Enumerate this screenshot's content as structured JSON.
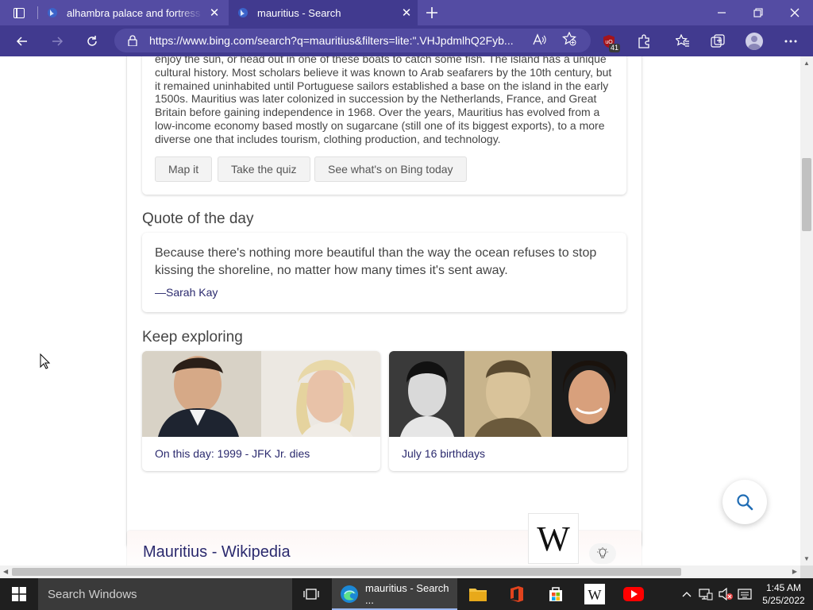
{
  "browser": {
    "tabs": [
      {
        "title": "alhambra palace and fortress sp",
        "active": false
      },
      {
        "title": "mauritius - Search",
        "active": true
      }
    ],
    "url": "https://www.bing.com/search?q=mauritius&filters=lite:\".VHJpdmlhQ2Fyb...",
    "extension_badge": "41",
    "accent_color": "#544ca3"
  },
  "page": {
    "description": "enjoy the sun, or head out in one of these boats to catch some fish. The island has a unique cultural history. Most scholars believe it was known to Arab seafarers by the 10th century, but it remained uninhabited until Portuguese sailors established a base on the island in the early 1500s. Mauritius was later colonized in succession by the Netherlands, France, and Great Britain before gaining independence in 1968. Over the years, Mauritius has evolved from a low-income economy based mostly on sugarcane (still one of its biggest exports), to a more diverse one that includes tourism, clothing production, and technology.",
    "buttons": [
      "Map it",
      "Take the quiz",
      "See what's on Bing today"
    ],
    "quote_heading": "Quote of the day",
    "quote_text": "Because there's nothing more beautiful than the way the ocean refuses to stop kissing the shoreline, no matter how many times it's sent away.",
    "quote_author": "—Sarah Kay",
    "explore_heading": "Keep exploring",
    "explore_items": [
      {
        "label": "On this day: 1999 - JFK Jr. dies"
      },
      {
        "label": "July 16 birthdays"
      }
    ],
    "wiki_title": "Mauritius - Wikipedia",
    "wiki_logo": "W"
  },
  "taskbar": {
    "search_placeholder": "Search Windows",
    "active_app": "mauritius - Search ...",
    "time": "1:45 AM",
    "date": "5/25/2022"
  }
}
